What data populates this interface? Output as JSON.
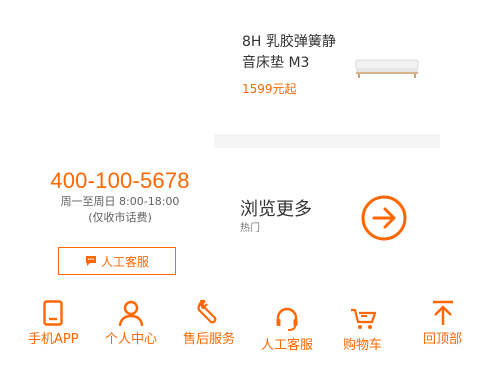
{
  "product": {
    "title": "8H 乳胶弹簧静音床垫 M3",
    "price": "1599元起"
  },
  "hotline": {
    "number": "400-100-5678",
    "hours": "周一至周日 8:00-18:00",
    "fee": "(仅收市话费)",
    "service_button_label": "人工客服"
  },
  "browse": {
    "title": "浏览更多",
    "subtitle": "热门"
  },
  "colors": {
    "accent": "#ff6700",
    "band": "#f5f5f5"
  },
  "bottom_nav": [
    {
      "label": "手机APP",
      "icon": "phone-icon"
    },
    {
      "label": "个人中心",
      "icon": "user-icon"
    },
    {
      "label": "售后服务",
      "icon": "wrench-icon"
    },
    {
      "label": "人工客服",
      "icon": "headset-icon"
    },
    {
      "label": "购物车",
      "icon": "cart-icon"
    },
    {
      "label": "回顶部",
      "icon": "back-to-top-icon"
    }
  ]
}
